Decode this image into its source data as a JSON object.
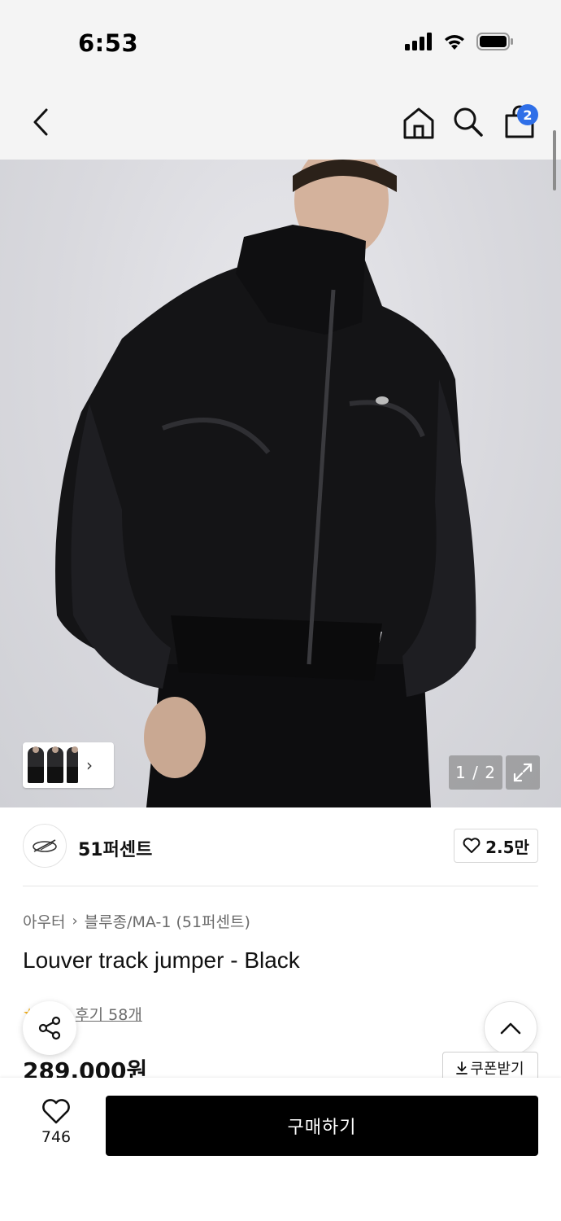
{
  "status_bar": {
    "time": "6:53"
  },
  "nav": {
    "cart_count": "2"
  },
  "gallery": {
    "page_counter": "1 / 2",
    "image_description_icon": "product-photo",
    "current_page": 1,
    "total_pages": 2
  },
  "brand": {
    "name": "51퍼센트",
    "likes": "2.5만"
  },
  "breadcrumb": {
    "category": "아우터",
    "subcategory": "블루종/MA-1 (51퍼센트)"
  },
  "product": {
    "title": "Louver track jumper - Black",
    "review_link": "후기 58개",
    "price": "289,000원",
    "coupon_label": "쿠폰받기"
  },
  "bottom_bar": {
    "wish_count": "746",
    "buy_label": "구매하기"
  },
  "colors": {
    "accent_badge": "#2f6fe8",
    "buy_button": "#000000",
    "rating_star": "#f2b01e"
  }
}
